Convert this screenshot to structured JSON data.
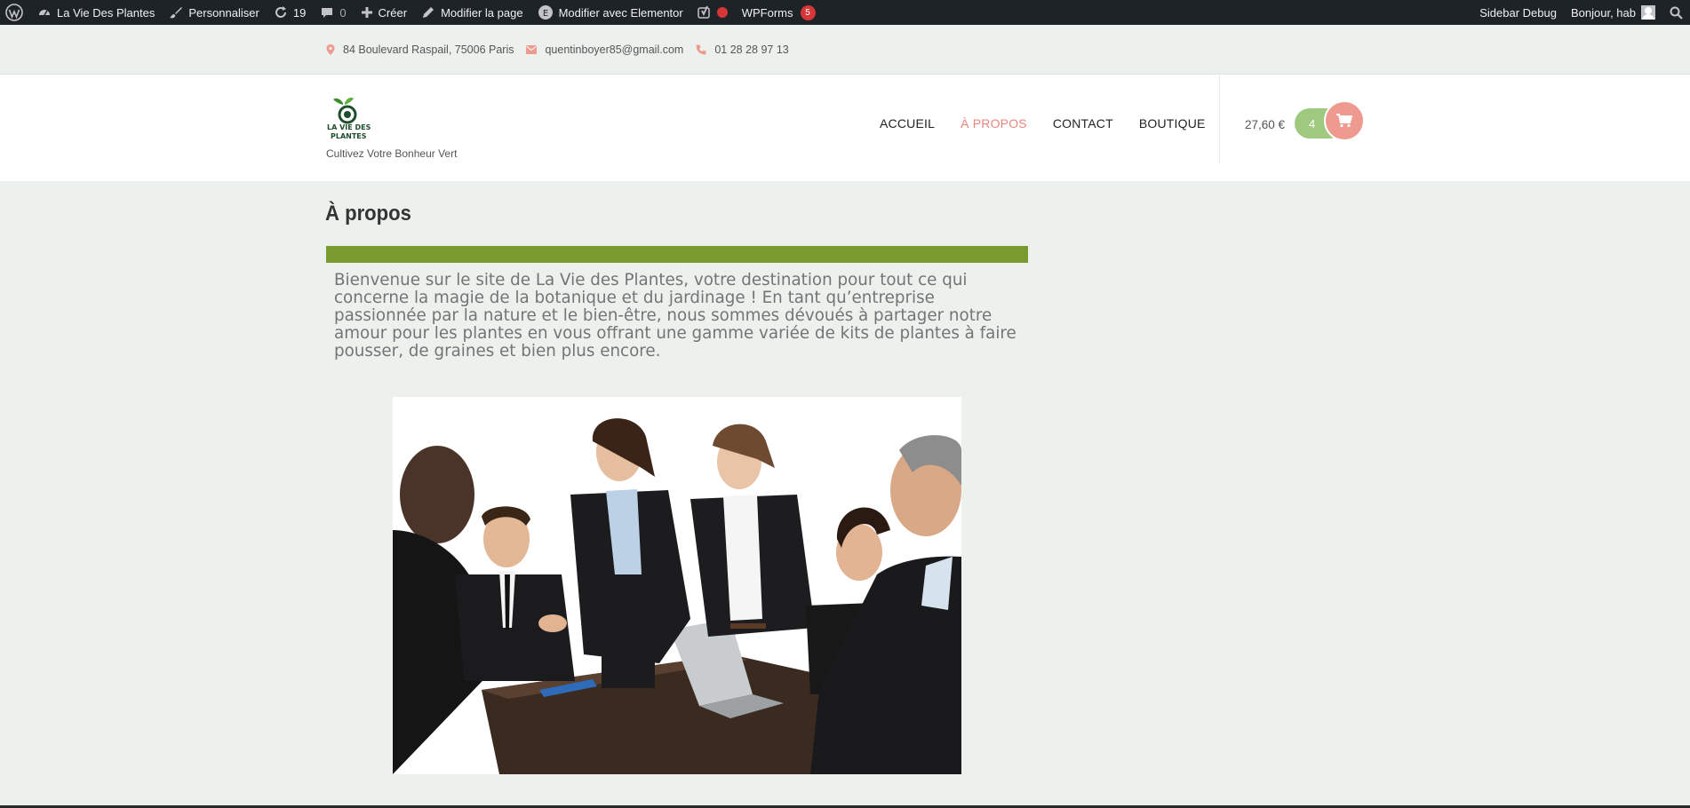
{
  "adminbar": {
    "site_name": "La Vie Des Plantes",
    "customize": "Personnaliser",
    "updates_count": "19",
    "comments_count": "0",
    "new": "Créer",
    "edit_page": "Modifier la page",
    "edit_elementor": "Modifier avec Elementor",
    "wpforms": "WPForms",
    "wpforms_badge": "5",
    "sidebar_debug": "Sidebar Debug",
    "greeting": "Bonjour, hab"
  },
  "topbar": {
    "address": "84 Boulevard Raspail, 75006 Paris",
    "email": "quentinboyer85@gmail.com",
    "phone": "01 28 28 97 13"
  },
  "header": {
    "logo_text_line1": "LA VIE DES",
    "logo_text_line2": "PLANTES",
    "tagline": "Cultivez Votre Bonheur Vert",
    "nav": [
      {
        "label": "Accueil"
      },
      {
        "label": "À propos"
      },
      {
        "label": "Contact"
      },
      {
        "label": "Boutique"
      }
    ],
    "cart_total": "27,60 €",
    "cart_count": "4"
  },
  "content": {
    "title": "À propos",
    "intro": "Bienvenue sur le site de La Vie des Plantes, votre destination pour tout ce qui concerne la magie de la botanique et du jardinage ! En tant qu’entreprise passionnée par la nature et le bien-être, nous sommes dévoués à partager notre amour pour les plantes en vous offrant une gamme variée de kits de plantes à faire pousser, de graines et bien plus encore."
  },
  "colors": {
    "accent": "#e8857d",
    "green_bar": "#799a2e",
    "cart_green": "#9ec97f",
    "cart_pink": "#ef9a8f"
  }
}
